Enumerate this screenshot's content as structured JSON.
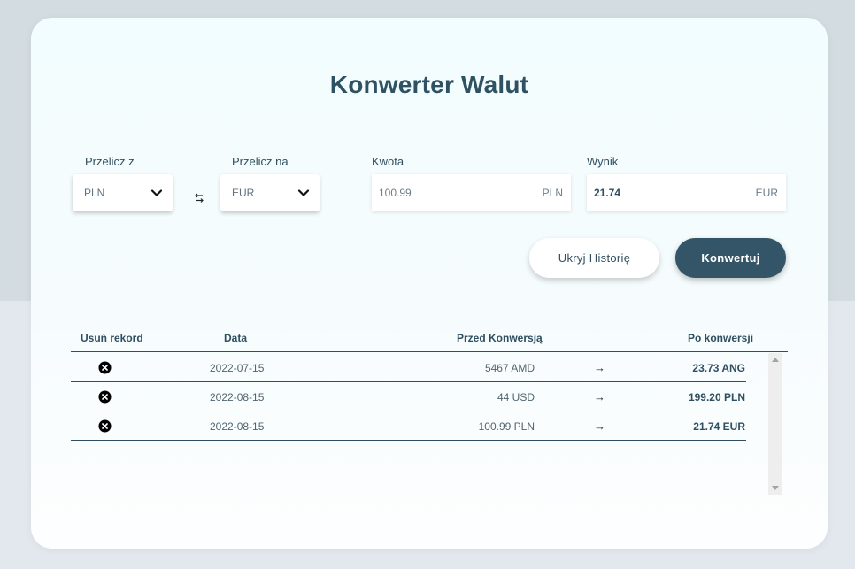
{
  "title": "Konwerter Walut",
  "from": {
    "label": "Przelicz z",
    "value": "PLN"
  },
  "to": {
    "label": "Przelicz na",
    "value": "EUR"
  },
  "amount": {
    "label": "Kwota",
    "value": "100.99",
    "currency": "PLN"
  },
  "result": {
    "label": "Wynik",
    "value": "21.74",
    "currency": "EUR"
  },
  "buttons": {
    "hide_history": "Ukryj Historię",
    "convert": "Konwertuj"
  },
  "table": {
    "headers": {
      "delete": "Usuń rekord",
      "date": "Data",
      "before": "Przed Konwersją",
      "after": "Po konwersji"
    },
    "rows": [
      {
        "date": "2022-07-15",
        "before": "5467 AMD",
        "arrow": "→",
        "after": "23.73 ANG"
      },
      {
        "date": "2022-08-15",
        "before": "44 USD",
        "arrow": "→",
        "after": "199.20 PLN"
      },
      {
        "date": "2022-08-15",
        "before": "100.99 PLN",
        "arrow": "→",
        "after": "21.74 EUR"
      }
    ]
  },
  "icons": {
    "chevron": "chevron-down-icon",
    "swap": "swap-icon",
    "delete": "close-circle-icon",
    "arrow": "arrow-right-icon"
  },
  "colors": {
    "accent": "#335567",
    "text": "#2f4f60",
    "card": "#f2fdff"
  }
}
